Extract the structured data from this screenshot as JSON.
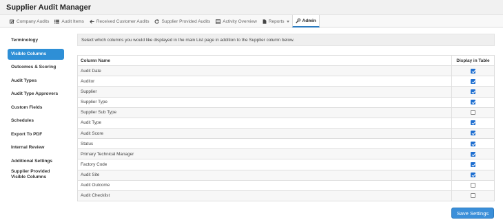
{
  "app": {
    "title": "Supplier Audit Manager"
  },
  "nav": {
    "items": [
      {
        "label": "Company Audits",
        "icon": "checkbox-edit-icon"
      },
      {
        "label": "Audit Items",
        "icon": "list-icon"
      },
      {
        "label": "Received Customer Audits",
        "icon": "arrow-left-icon"
      },
      {
        "label": "Supplier Provided Audits",
        "icon": "refresh-icon"
      },
      {
        "label": "Activity Overview",
        "icon": "table-icon"
      },
      {
        "label": "Reports",
        "icon": "document-icon"
      },
      {
        "label": "Admin",
        "icon": "wrench-icon"
      }
    ],
    "active": "Admin"
  },
  "sidebar": {
    "items": [
      {
        "label": "Terminology"
      },
      {
        "label": "Visible Columns"
      },
      {
        "label": "Outcomes & Scoring"
      },
      {
        "label": "Audit Types"
      },
      {
        "label": "Audit Type Approvers"
      },
      {
        "label": "Custom Fields"
      },
      {
        "label": "Schedules"
      },
      {
        "label": "Export To PDF"
      },
      {
        "label": "Internal Review"
      },
      {
        "label": "Additional Settings"
      },
      {
        "label": "Supplier Provided Visible Columns"
      }
    ],
    "active": "Visible Columns"
  },
  "info": {
    "text": "Select which columns you would like displayed in the main List page in addition to the Supplier column below."
  },
  "table": {
    "headers": {
      "name": "Column Name",
      "display": "Display in Table"
    },
    "rows": [
      {
        "name": "Audit Date",
        "checked": true
      },
      {
        "name": "Auditor",
        "checked": true
      },
      {
        "name": "Supplier",
        "checked": true
      },
      {
        "name": "Supplier Type",
        "checked": true
      },
      {
        "name": "Supplier Sub Type",
        "checked": false
      },
      {
        "name": "Audit Type",
        "checked": true
      },
      {
        "name": "Audit Score",
        "checked": true
      },
      {
        "name": "Status",
        "checked": true
      },
      {
        "name": "Primary Technical Manager",
        "checked": true
      },
      {
        "name": "Factory Code",
        "checked": true
      },
      {
        "name": "Audit Site",
        "checked": true
      },
      {
        "name": "Audit Outcome",
        "checked": false
      },
      {
        "name": "Audit Checklist",
        "checked": false
      }
    ]
  },
  "actions": {
    "save_label": "Save Settings"
  },
  "colors": {
    "accent": "#2e8fd6",
    "checkbox": "#1f6fd0",
    "button": "#3b8fd9"
  }
}
